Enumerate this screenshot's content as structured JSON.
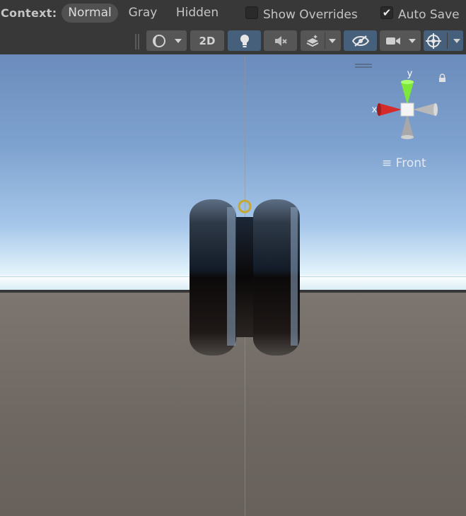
{
  "context_bar": {
    "label": "Context:",
    "modes": [
      "Normal",
      "Gray",
      "Hidden"
    ],
    "active_mode": "Normal",
    "show_overrides": {
      "label": "Show Overrides",
      "checked": false
    },
    "auto_save": {
      "label": "Auto Save",
      "checked": true
    }
  },
  "toolbar": {
    "two_d_label": "2D",
    "lighting_on": true,
    "visibility_on": true,
    "gizmos_on": true
  },
  "scene": {
    "orientation_gizmo": {
      "x_label": "x",
      "y_label": "y",
      "view_label": "Front"
    }
  },
  "colors": {
    "toolbar_bg": "#383838",
    "button_bg": "#565656",
    "button_active": "#46607c",
    "axis_x": "#d62b2b",
    "axis_y": "#7ee83a"
  }
}
